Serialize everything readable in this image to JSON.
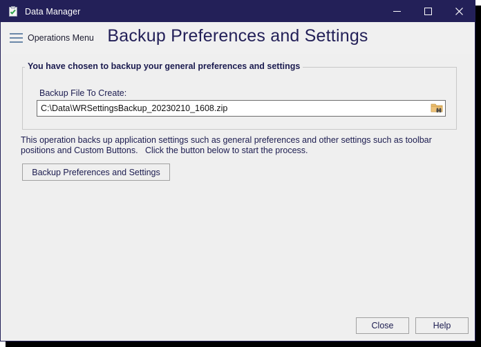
{
  "window": {
    "title": "Data Manager",
    "app_icon": "clipboard-check-icon",
    "titlebar_color": "#232058",
    "minimize_label": "Minimize",
    "maximize_label": "Maximize",
    "close_label": "Close"
  },
  "header": {
    "menu_icon": "hamburger-menu-icon",
    "menu_label": "Operations Menu",
    "page_title": "Backup Preferences and Settings"
  },
  "group": {
    "legend": "You have chosen to backup your general preferences and settings",
    "field_label": "Backup File To Create:",
    "file_value": "C:\\Data\\WRSettingsBackup_20230210_1608.zip",
    "browse_icon": "folder-browse-icon"
  },
  "description": "This operation backs up application settings such as general preferences and other settings such as toolbar\npositions and Custom Buttons.   Click the button below to start the process.",
  "actions": {
    "backup_button": "Backup Preferences and Settings"
  },
  "footer": {
    "close_button": "Close",
    "help_button": "Help"
  }
}
